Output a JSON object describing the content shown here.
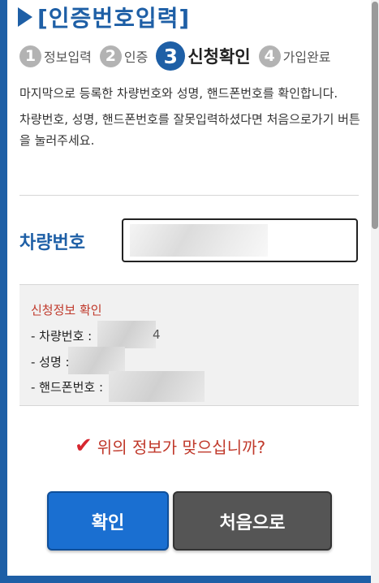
{
  "header": {
    "title": "[인증번호입력]"
  },
  "steps": [
    {
      "num": "1",
      "label": "정보입력"
    },
    {
      "num": "2",
      "label": "인증"
    },
    {
      "num": "3",
      "label": "신청확인"
    },
    {
      "num": "4",
      "label": "가입완료"
    }
  ],
  "description": {
    "line1": "마지막으로 등록한 차량번호와 성명, 핸드폰번호를 확인합니다.",
    "line2": "차량번호, 성명, 핸드폰번호를 잘못입력하셨다면 처음으로가기 버튼을 눌러주세요."
  },
  "car_field": {
    "label": "차량번호",
    "value": ""
  },
  "confirm": {
    "title": "신청정보 확인",
    "car": "- 차량번호 :",
    "car_tail": "4",
    "name": "- 성명 :",
    "phone": "- 핸드폰번호 :"
  },
  "question": "위의 정보가 맞으십니까?",
  "buttons": {
    "ok": "확인",
    "reset": "처음으로"
  },
  "colors": {
    "brand": "#1e5fa6",
    "accent_red": "#c0392b",
    "ok_button": "#1a6fd1",
    "reset_button": "#555555"
  }
}
